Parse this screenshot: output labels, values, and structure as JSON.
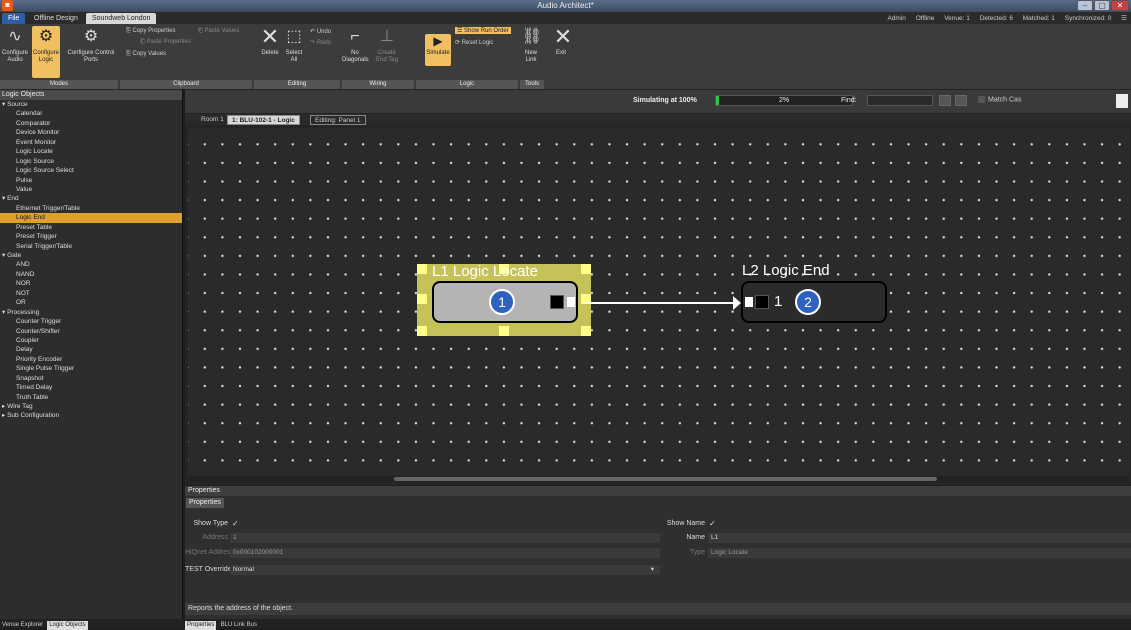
{
  "window": {
    "title": "Audio Architect*",
    "minimize": "–",
    "maximize": "▢",
    "close": "✕"
  },
  "ribbon_tabs": [
    {
      "label": "File"
    },
    {
      "label": "Offline Design"
    },
    {
      "label": "Soundweb London"
    }
  ],
  "status": {
    "admin": "Admin",
    "mode": "Offline",
    "venue": "Venue: 1",
    "detected": "Detected: 6",
    "matched": "Matched: 1",
    "synchronized": "Synchronized: 0"
  },
  "ribbon": {
    "configure_audio": "Configure Audio",
    "configure_logic": "Configure Logic",
    "configure_control_ports": "Configure Control Ports",
    "copy_properties": "Copy Properties",
    "paste_values": "Paste Values",
    "paste_properties": "Paste Properties",
    "copy_values": "Copy Values",
    "delete": "Delete",
    "select_all": "Select All",
    "undo": "Undo",
    "redo": "Redo",
    "no_diagonals": "No Diagonals",
    "create_end_tag": "Create End Tag",
    "simulate": "Simulate",
    "show_run_order": "Show Run Order",
    "reset_logic": "Reset Logic",
    "new_link": "New Link",
    "exit": "Exit",
    "groups": {
      "modes": "Modes",
      "clipboard": "Clipboard",
      "editing": "Editing",
      "wiring": "Wiring",
      "logic": "Logic",
      "tools": "Tools"
    }
  },
  "left_panel": {
    "header": "Logic Objects",
    "tree": [
      {
        "label": "Source",
        "type": "cat"
      },
      {
        "label": "Calendar"
      },
      {
        "label": "Comparator"
      },
      {
        "label": "Device Monitor"
      },
      {
        "label": "Event Monitor"
      },
      {
        "label": "Logic Locate"
      },
      {
        "label": "Logic Source"
      },
      {
        "label": "Logic Source Select"
      },
      {
        "label": "Pulse"
      },
      {
        "label": "Value"
      },
      {
        "label": "End",
        "type": "cat"
      },
      {
        "label": "Ethernet Trigger/Table"
      },
      {
        "label": "Logic End",
        "selected": true
      },
      {
        "label": "Preset Table"
      },
      {
        "label": "Preset Trigger"
      },
      {
        "label": "Serial Trigger/Table"
      },
      {
        "label": "Gate",
        "type": "cat"
      },
      {
        "label": "AND"
      },
      {
        "label": "NAND"
      },
      {
        "label": "NOR"
      },
      {
        "label": "NOT"
      },
      {
        "label": "OR"
      },
      {
        "label": "Processing",
        "type": "cat"
      },
      {
        "label": "Counter Trigger"
      },
      {
        "label": "Counter/Shifter"
      },
      {
        "label": "Coupler"
      },
      {
        "label": "Delay"
      },
      {
        "label": "Priority Encoder"
      },
      {
        "label": "Single Pulse Trigger"
      },
      {
        "label": "Snapshot"
      },
      {
        "label": "Timed Delay"
      },
      {
        "label": "Truth Table"
      },
      {
        "label": "Wire Tag",
        "type": "cat",
        "collapsed": true
      },
      {
        "label": "Sub Configuration",
        "type": "cat",
        "collapsed": true
      }
    ],
    "bottom_tabs": [
      {
        "label": "Venue Explorer"
      },
      {
        "label": "Logic Objects",
        "active": true
      }
    ]
  },
  "sim": {
    "label": "Simulating at 100%",
    "progress_text": "2%",
    "progress": 0.02,
    "find_label": "Find:",
    "find_value": "",
    "match_case": "Match Cas"
  },
  "breadcrumb": {
    "room": "Room 1",
    "device": "1: BLU-102-1 - Logic",
    "editing": "Editing: Panel 1"
  },
  "blocks": [
    {
      "title": "L1  Logic Locate",
      "badge": "1"
    },
    {
      "title": "L2  Logic End",
      "badge": "2",
      "pin_label": "1"
    }
  ],
  "properties": {
    "header": "Properties",
    "tab": "Properties",
    "show_type_label": "Show Type",
    "show_type_value": "✓",
    "address_label": "Address",
    "address_value": "1",
    "hiqnet_label": "HiQnet Address",
    "hiqnet_value": "0x000102000001",
    "test_override_label": "TEST Override",
    "test_override_value": "Normal",
    "show_name_label": "Show Name",
    "show_name_value": "✓",
    "name_label": "Name",
    "name_value": "L1",
    "type_label": "Type",
    "type_value": "Logic Locate",
    "description": "Reports the address of the object.",
    "bottom_tabs": [
      {
        "label": "Properties",
        "active": true
      },
      {
        "label": "BLU Link Bus"
      }
    ]
  }
}
